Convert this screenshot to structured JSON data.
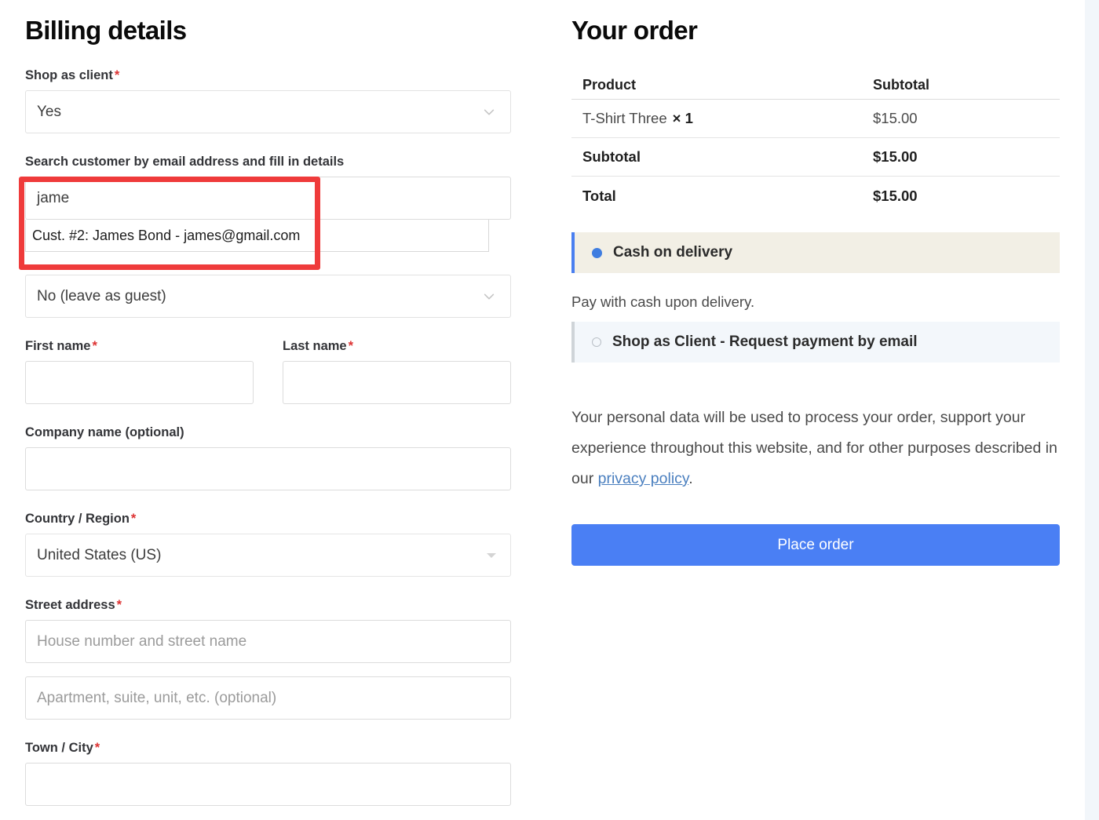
{
  "billing": {
    "heading": "Billing details",
    "shop_as_client": {
      "label": "Shop as client",
      "required_mark": "*",
      "value": "Yes"
    },
    "customer_search": {
      "label": "Search customer by email address and fill in details",
      "value": "jame",
      "suggestions": [
        "Cust. #2: James Bond - james@gmail.com"
      ]
    },
    "create_account": {
      "value": "No (leave as guest)"
    },
    "first_name": {
      "label": "First name",
      "required_mark": "*",
      "value": ""
    },
    "last_name": {
      "label": "Last name",
      "required_mark": "*",
      "value": ""
    },
    "company": {
      "label": "Company name (optional)",
      "value": ""
    },
    "country": {
      "label": "Country / Region",
      "required_mark": "*",
      "value": "United States (US)"
    },
    "street": {
      "label": "Street address",
      "required_mark": "*",
      "line1_placeholder": "House number and street name",
      "line1_value": "",
      "line2_placeholder": "Apartment, suite, unit, etc. (optional)",
      "line2_value": ""
    },
    "city": {
      "label": "Town / City",
      "required_mark": "*",
      "value": ""
    }
  },
  "order": {
    "heading": "Your order",
    "columns": {
      "product": "Product",
      "subtotal": "Subtotal"
    },
    "items": [
      {
        "name": "T-Shirt Three",
        "qty": "× 1",
        "amount": "$15.00"
      }
    ],
    "subtotal": {
      "label": "Subtotal",
      "amount": "$15.00"
    },
    "total": {
      "label": "Total",
      "amount": "$15.00"
    },
    "payment_methods": [
      {
        "label": "Cash on delivery",
        "selected": true,
        "description": "Pay with cash upon delivery."
      },
      {
        "label": "Shop as Client - Request payment by email",
        "selected": false,
        "description": ""
      }
    ],
    "privacy": {
      "text_before": "Your personal data will be used to process your order, support your experience throughout this website, and for other purposes described in our ",
      "link_text": "privacy policy",
      "text_after": "."
    },
    "place_order_label": "Place order"
  },
  "annotation": {
    "highlight_color": "#ef3b3b"
  },
  "colors": {
    "accent_blue": "#4a7ff4",
    "required_red": "#dd3333",
    "cod_background": "#f2efe5",
    "sac_background": "#f3f7fb"
  }
}
